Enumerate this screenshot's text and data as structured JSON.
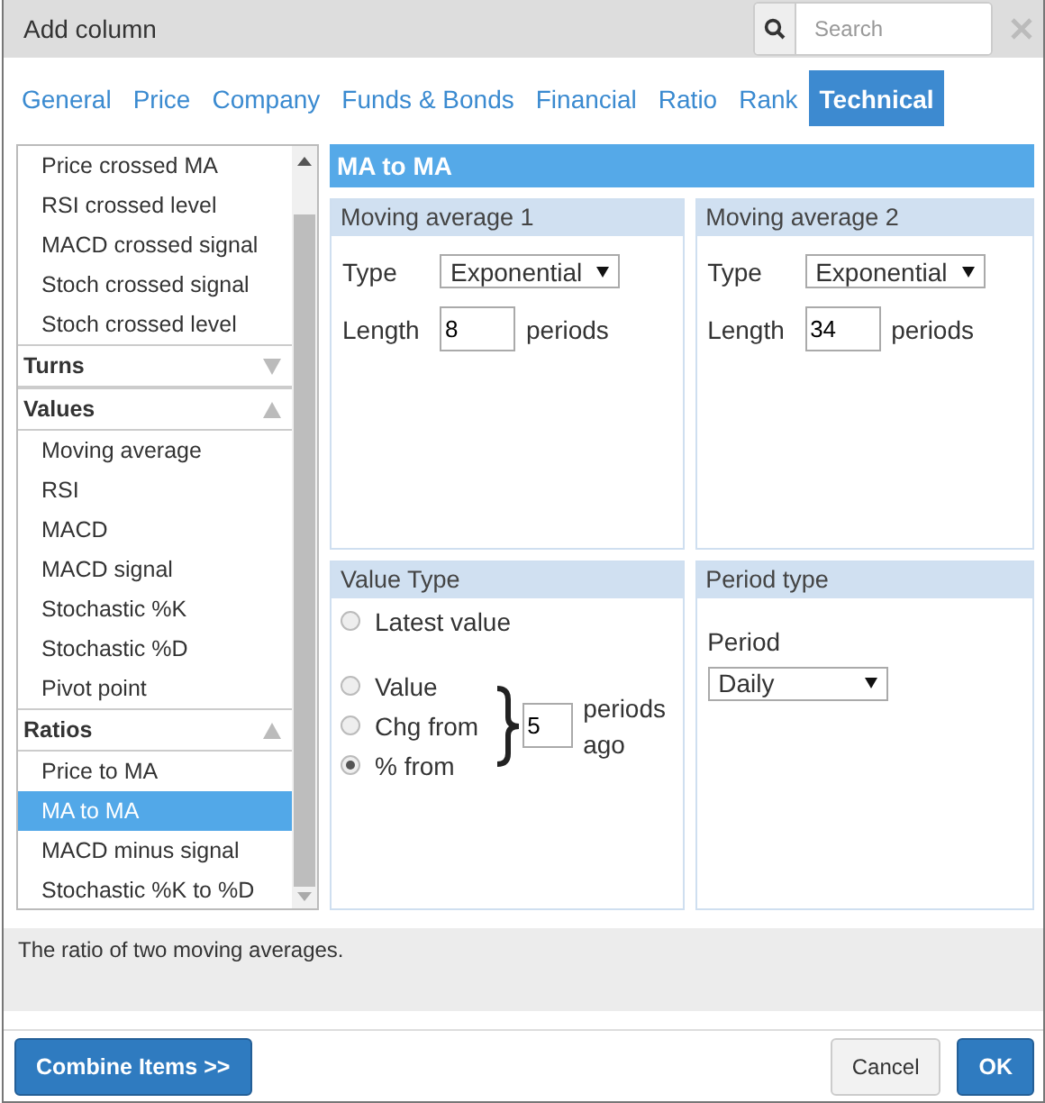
{
  "window": {
    "title": "Add column"
  },
  "search": {
    "placeholder": "Search"
  },
  "tabs": [
    {
      "label": "General",
      "selected": false
    },
    {
      "label": "Price",
      "selected": false
    },
    {
      "label": "Company",
      "selected": false
    },
    {
      "label": "Funds & Bonds",
      "selected": false
    },
    {
      "label": "Financial",
      "selected": false
    },
    {
      "label": "Ratio",
      "selected": false
    },
    {
      "label": "Rank",
      "selected": false
    },
    {
      "label": "Technical",
      "selected": true
    }
  ],
  "list": {
    "groups": [
      {
        "items": [
          {
            "label": "Price crossed MA",
            "selected": false
          },
          {
            "label": "RSI crossed level",
            "selected": false
          },
          {
            "label": "MACD crossed signal",
            "selected": false
          },
          {
            "label": "Stoch crossed signal",
            "selected": false
          },
          {
            "label": "Stoch crossed level",
            "selected": false
          }
        ]
      },
      {
        "title": "Turns",
        "expanded": false
      },
      {
        "title": "Values",
        "expanded": true,
        "items": [
          {
            "label": "Moving average",
            "selected": false
          },
          {
            "label": "RSI",
            "selected": false
          },
          {
            "label": "MACD",
            "selected": false
          },
          {
            "label": "MACD signal",
            "selected": false
          },
          {
            "label": "Stochastic %K",
            "selected": false
          },
          {
            "label": "Stochastic %D",
            "selected": false
          },
          {
            "label": "Pivot point",
            "selected": false
          }
        ]
      },
      {
        "title": "Ratios",
        "expanded": true,
        "items": [
          {
            "label": "Price to MA",
            "selected": false
          },
          {
            "label": "MA to MA",
            "selected": true
          },
          {
            "label": "MACD minus signal",
            "selected": false
          },
          {
            "label": "Stochastic %K to %D",
            "selected": false
          }
        ]
      }
    ]
  },
  "detail": {
    "title": "MA to MA",
    "moving_averages": [
      {
        "title": "Moving average 1",
        "type_label": "Type",
        "type_value": "Exponential",
        "length_label": "Length",
        "length_value": "8",
        "unit": "periods"
      },
      {
        "title": "Moving average 2",
        "type_label": "Type",
        "type_value": "Exponential",
        "length_label": "Length",
        "length_value": "34",
        "unit": "periods"
      }
    ],
    "value_type": {
      "title": "Value Type",
      "options": [
        {
          "kind": "single",
          "label": "Latest value",
          "selected": false
        },
        {
          "kind": "grouped",
          "label": "Value",
          "selected": false
        },
        {
          "kind": "grouped",
          "label": "Chg from",
          "selected": false
        },
        {
          "kind": "grouped",
          "label": "% from",
          "selected": true
        }
      ],
      "periods_value": "5",
      "periods_label": "periods ago"
    },
    "period_type": {
      "title": "Period type",
      "label": "Period",
      "value": "Daily"
    }
  },
  "description": "The ratio of two moving averages.",
  "buttons": [
    {
      "label": "Combine Items >>",
      "kind": "primary"
    },
    {
      "label": "Cancel",
      "kind": "default"
    },
    {
      "label": "OK",
      "kind": "primary"
    }
  ]
}
